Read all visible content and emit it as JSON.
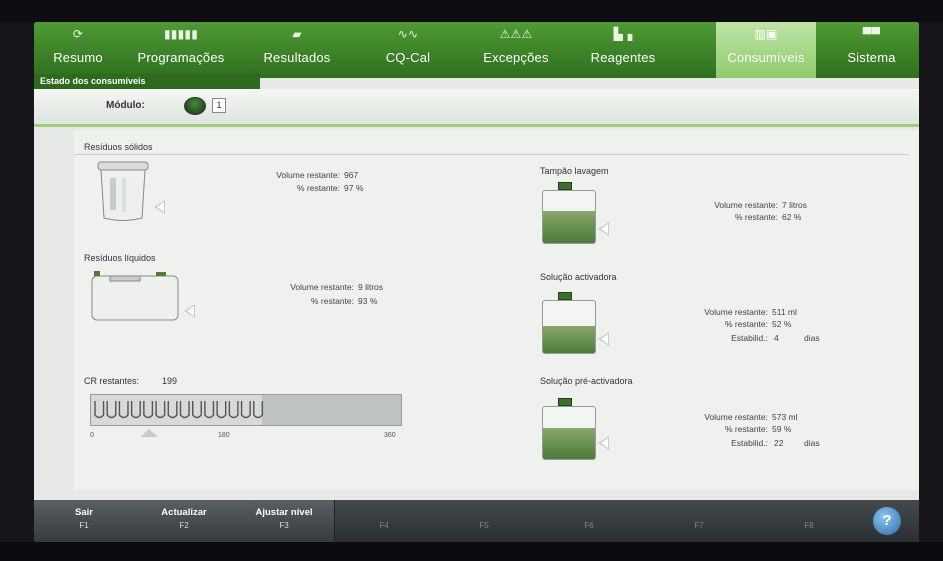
{
  "tabs": [
    {
      "label": "Resumo",
      "icon": "refresh-icon"
    },
    {
      "label": "Programações",
      "icon": "grid-icon"
    },
    {
      "label": "Resultados",
      "icon": "book-icon"
    },
    {
      "label": "CQ-Cal",
      "icon": "wave-icon"
    },
    {
      "label": "Excepções",
      "icon": "alert-icon"
    },
    {
      "label": "Reagentes",
      "icon": "reagent-icon"
    },
    {
      "label": "Consumíveis",
      "icon": "consumable-icon"
    },
    {
      "label": "Sistema",
      "icon": "system-icon"
    }
  ],
  "breadcrumb": "Estado dos consumíveis",
  "module": {
    "label": "Módulo:",
    "number": "1"
  },
  "solid_waste": {
    "title": "Resíduos sólidos",
    "volume_label": "Volume restante:",
    "volume_value": "967",
    "pct_label": "% restante:",
    "pct_value": "97 %"
  },
  "liquid_waste": {
    "title": "Resíduos líquidos",
    "volume_label": "Volume restante:",
    "volume_value": "9 litros",
    "pct_label": "% restante:",
    "pct_value": "93 %"
  },
  "cr": {
    "label": "CR restantes:",
    "value": "199",
    "ticks": [
      "0",
      "180",
      "360"
    ],
    "level_fraction": 0.55
  },
  "wash_buffer": {
    "title": "Tampão lavagem",
    "volume_label": "Volume restante:",
    "volume_value": "7 litros",
    "pct_label": "% restante:",
    "pct_value": "62 %",
    "fill": 0.62
  },
  "activator": {
    "title": "Solução activadora",
    "volume_label": "Volume restante:",
    "volume_value": "511 ml",
    "pct_label": "% restante:",
    "pct_value": "52 %",
    "stab_label": "Estabilid.:",
    "stab_value": "4",
    "stab_unit": "dias",
    "fill": 0.52
  },
  "preactivator": {
    "title": "Solução pré-activadora",
    "volume_label": "Volume restante:",
    "volume_value": "573 ml",
    "pct_label": "% restante:",
    "pct_value": "59 %",
    "stab_label": "Estabilid.:",
    "stab_value": "22",
    "stab_unit": "dias",
    "fill": 0.59
  },
  "fkeys": [
    {
      "label": "Sair",
      "key": "F1"
    },
    {
      "label": "Actualizar",
      "key": "F2"
    },
    {
      "label": "Ajustar nível",
      "key": "F3"
    },
    {
      "label": "",
      "key": "F4"
    },
    {
      "label": "",
      "key": "F5"
    },
    {
      "label": "",
      "key": "F6"
    },
    {
      "label": "",
      "key": "F7"
    },
    {
      "label": "",
      "key": "F8"
    }
  ],
  "help_label": "?",
  "colors": {
    "accent_green": "#4f9a35",
    "active_tab": "#8fcc6c",
    "fluid": "#4e7a3a"
  }
}
